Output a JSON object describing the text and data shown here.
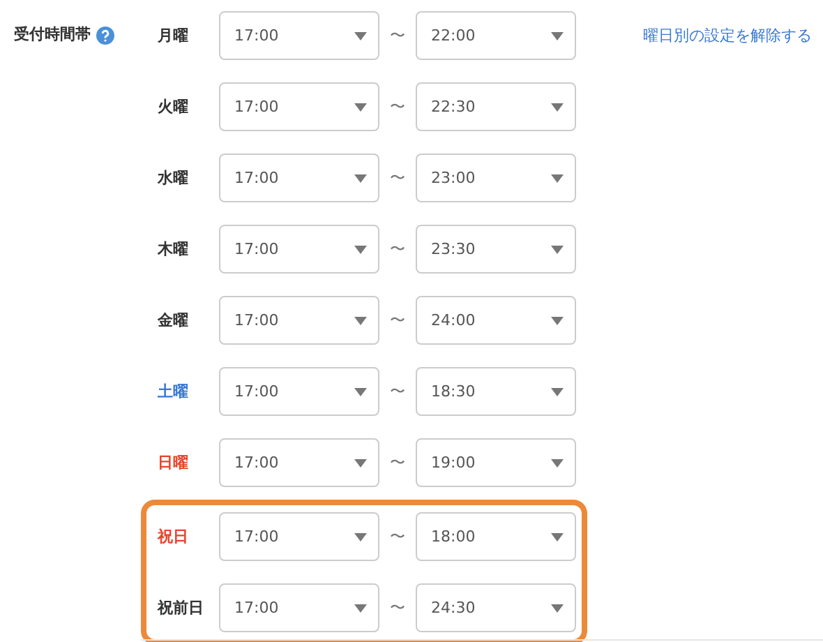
{
  "section": {
    "label": "受付時間帯",
    "clear_link": "曜日別の設定を解除する"
  },
  "days": [
    {
      "label": "月曜",
      "color": "#333333",
      "from": "17:00",
      "to": "22:00",
      "highlighted": false
    },
    {
      "label": "火曜",
      "color": "#333333",
      "from": "17:00",
      "to": "22:30",
      "highlighted": false
    },
    {
      "label": "水曜",
      "color": "#333333",
      "from": "17:00",
      "to": "23:00",
      "highlighted": false
    },
    {
      "label": "木曜",
      "color": "#333333",
      "from": "17:00",
      "to": "23:30",
      "highlighted": false
    },
    {
      "label": "金曜",
      "color": "#333333",
      "from": "17:00",
      "to": "24:00",
      "highlighted": false
    },
    {
      "label": "土曜",
      "color": "#3a78d4",
      "from": "17:00",
      "to": "18:30",
      "highlighted": false
    },
    {
      "label": "日曜",
      "color": "#e8452c",
      "from": "17:00",
      "to": "19:00",
      "highlighted": false
    },
    {
      "label": "祝日",
      "color": "#e8452c",
      "from": "17:00",
      "to": "18:00",
      "highlighted": true
    },
    {
      "label": "祝前日",
      "color": "#333333",
      "from": "17:00",
      "to": "24:30",
      "highlighted": true
    }
  ],
  "separator": "〜"
}
